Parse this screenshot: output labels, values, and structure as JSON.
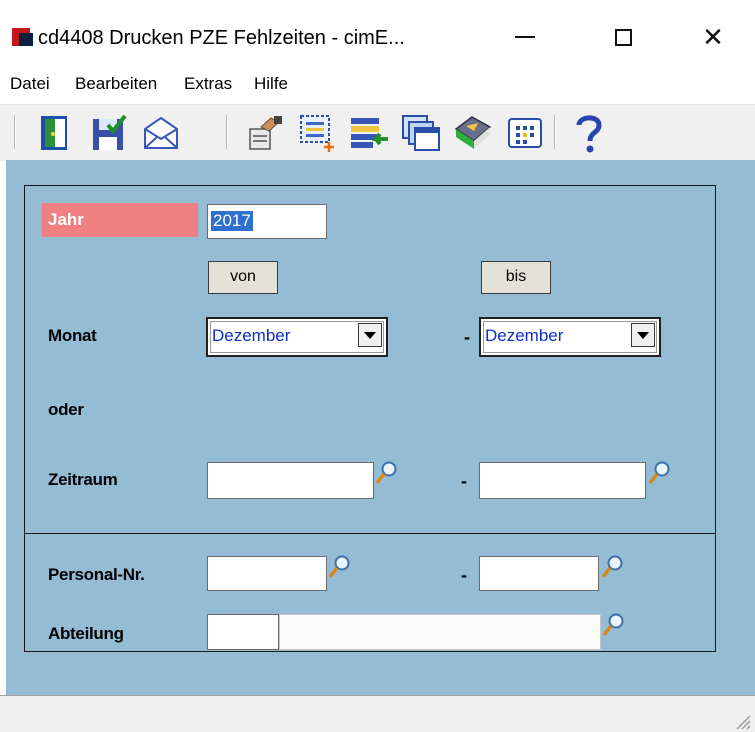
{
  "window": {
    "title": "cd4408 Drucken PZE Fehlzeiten - cimE..."
  },
  "menu": {
    "items": [
      {
        "label": "Datei"
      },
      {
        "label": "Bearbeiten"
      },
      {
        "label": "Extras"
      },
      {
        "label": "Hilfe"
      }
    ]
  },
  "toolbar": {
    "icons": [
      "exit-door-icon",
      "save-icon",
      "mail-icon",
      "printer-setup-icon",
      "new-select-icon",
      "list-import-icon",
      "windows-icon",
      "book-icon",
      "calendar-grid-icon",
      "help-icon"
    ]
  },
  "form": {
    "jahr_label": "Jahr",
    "jahr_value": "2017",
    "von_label": "von",
    "bis_label": "bis",
    "monat_label": "Monat",
    "monat_von": "Dezember",
    "monat_bis": "Dezember",
    "oder_label": "oder",
    "zeitraum_label": "Zeitraum",
    "zeitraum_von": "",
    "zeitraum_bis": "",
    "personal_label": "Personal-Nr.",
    "personal_von": "",
    "personal_bis": "",
    "abteilung_label": "Abteilung",
    "abteilung_code": "",
    "abteilung_name": "",
    "dash": "-"
  },
  "colors": {
    "background": "#95bcd5",
    "jahr_label_bg": "#f08080",
    "selection": "#2f6fd0"
  }
}
